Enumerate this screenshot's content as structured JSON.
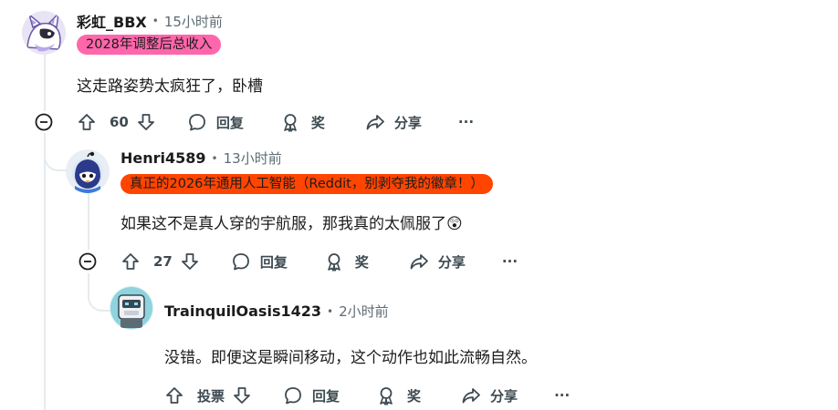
{
  "colors": {
    "flair1_bg": "#ff66ac",
    "flair2_bg": "#ff4500",
    "thread_line": "#e5ebee",
    "meta_gray": "#5c6c74"
  },
  "comments": [
    {
      "author": "彩虹_BBX",
      "time": "15小时前",
      "flair": "2028年调整后总收入",
      "body": "这走路姿势太疯狂了，卧槽",
      "actions": {
        "score": "60",
        "reply": "回复",
        "award": "奖",
        "share": "分享",
        "more": "···"
      }
    },
    {
      "author": "Henri4589",
      "time": "13小时前",
      "flair": "真正的2026年通用人工智能（Reddit，别剥夺我的徽章！）",
      "body": "如果这不是真人穿的宇航服，那我真的太佩服了",
      "emoji": "😲",
      "actions": {
        "score": "27",
        "reply": "回复",
        "award": "奖",
        "share": "分享",
        "more": "···"
      }
    },
    {
      "author": "TrainquilOasis1423",
      "time": "2小时前",
      "body": "没错。即便这是瞬间移动，这个动作也如此流畅自然。",
      "actions": {
        "score": "投票",
        "reply": "回复",
        "award": "奖",
        "share": "分享",
        "more": "···"
      }
    }
  ],
  "separator": "•",
  "icons": [
    "upvote-icon",
    "downvote-icon",
    "reply-icon",
    "award-icon",
    "share-icon",
    "more-icon",
    "collapse-icon"
  ]
}
